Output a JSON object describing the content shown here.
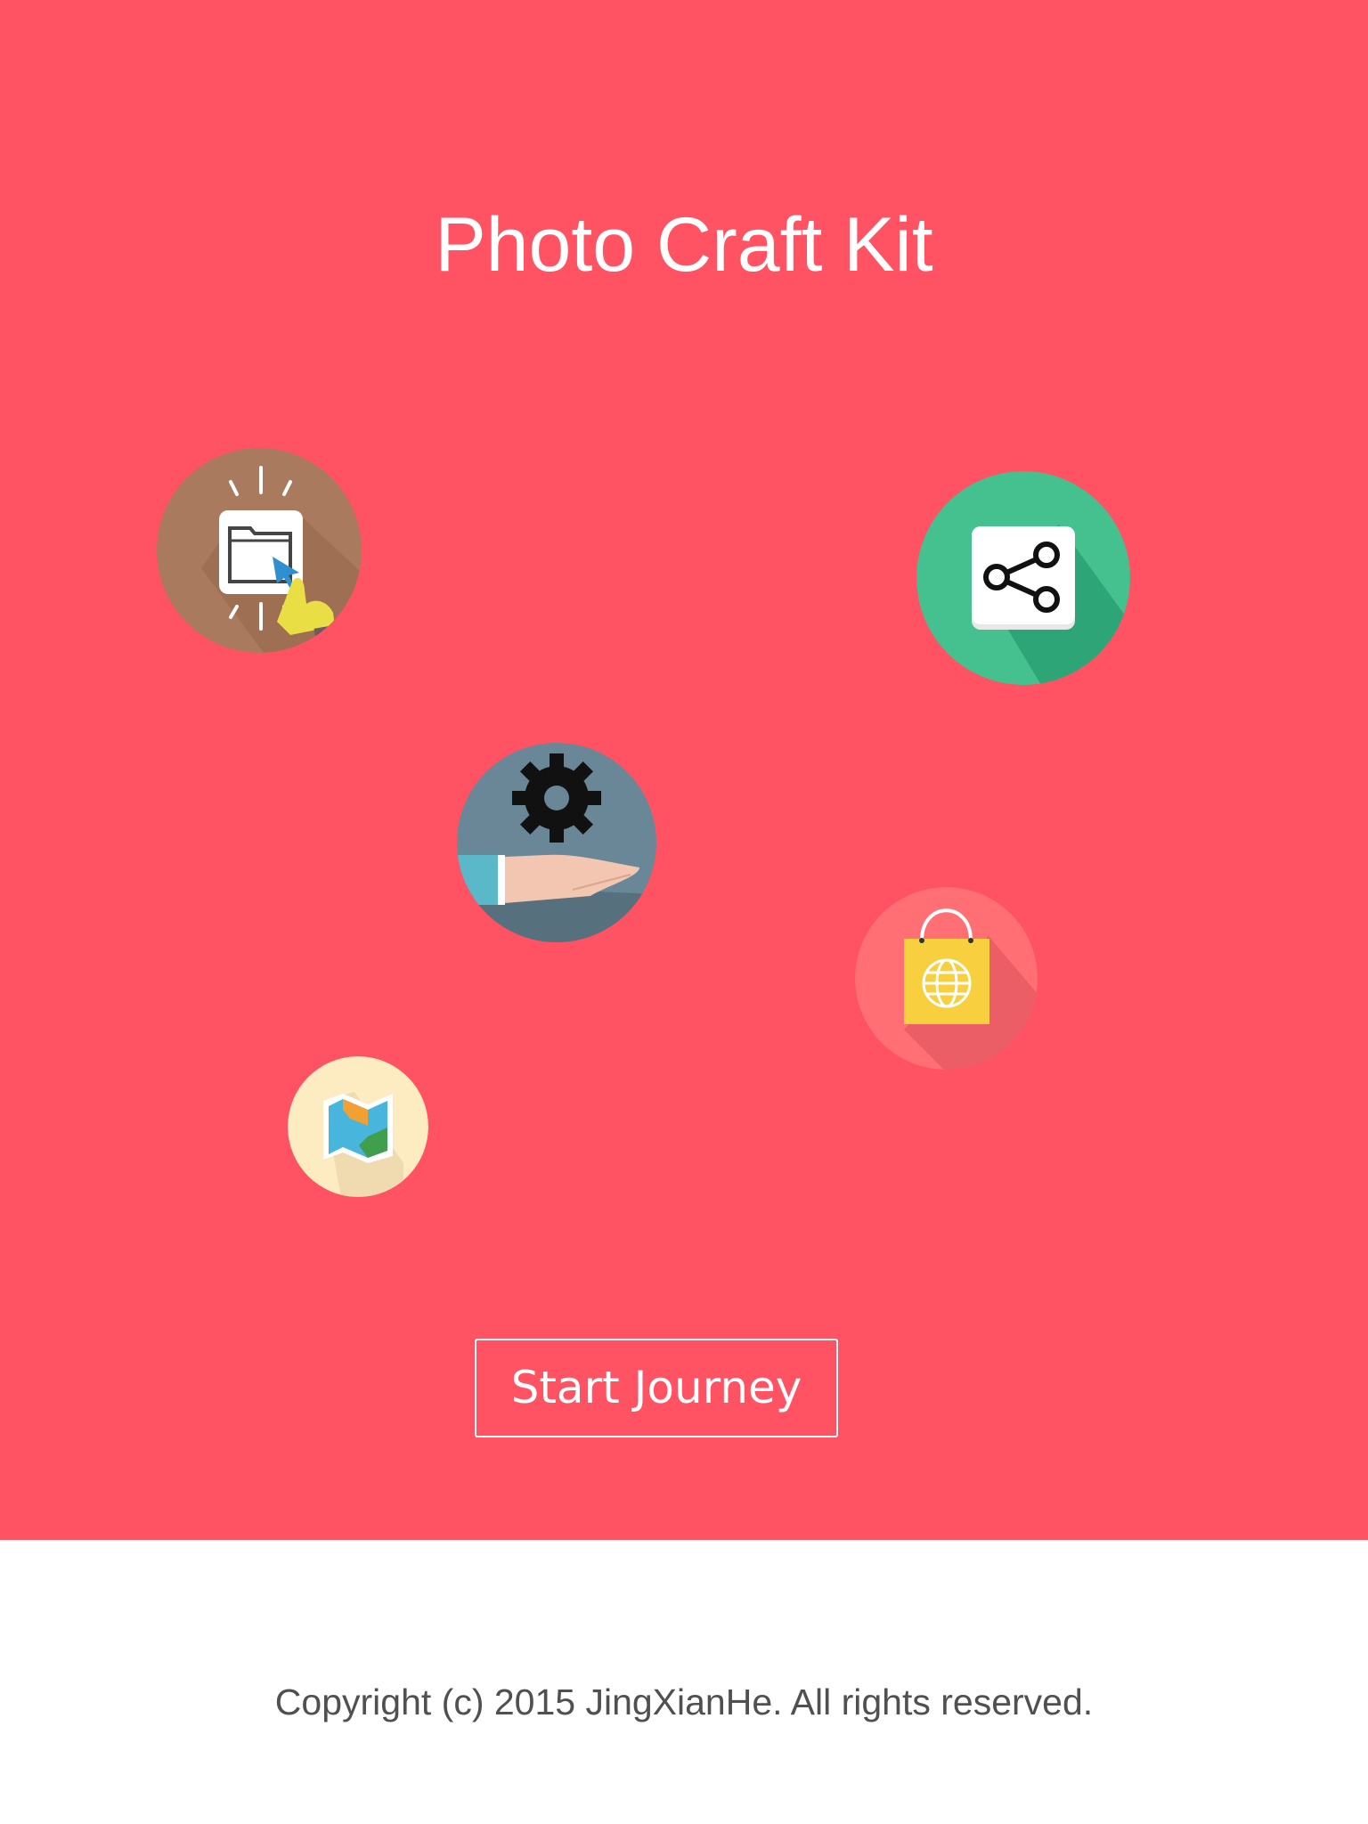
{
  "app": {
    "title": "Photo Craft Kit"
  },
  "features": [
    {
      "name": "open-folder",
      "icon": "folder-cursor-icon",
      "bg": "#a97a5d"
    },
    {
      "name": "share",
      "icon": "share-icon",
      "bg": "#45c08f"
    },
    {
      "name": "settings",
      "icon": "gear-hand-icon",
      "bg": "#6a8797"
    },
    {
      "name": "store",
      "icon": "shopping-bag-globe-icon",
      "bg": "#ff6f74"
    },
    {
      "name": "map",
      "icon": "map-icon",
      "bg": "#fdebc2"
    }
  ],
  "actions": {
    "start_label": "Start Journey"
  },
  "footer": {
    "copyright": "Copyright (c) 2015 JingXianHe. All rights reserved."
  },
  "colors": {
    "hero_bg": "#ff5262",
    "footer_bg": "#ffffff",
    "footer_text": "#505050"
  }
}
